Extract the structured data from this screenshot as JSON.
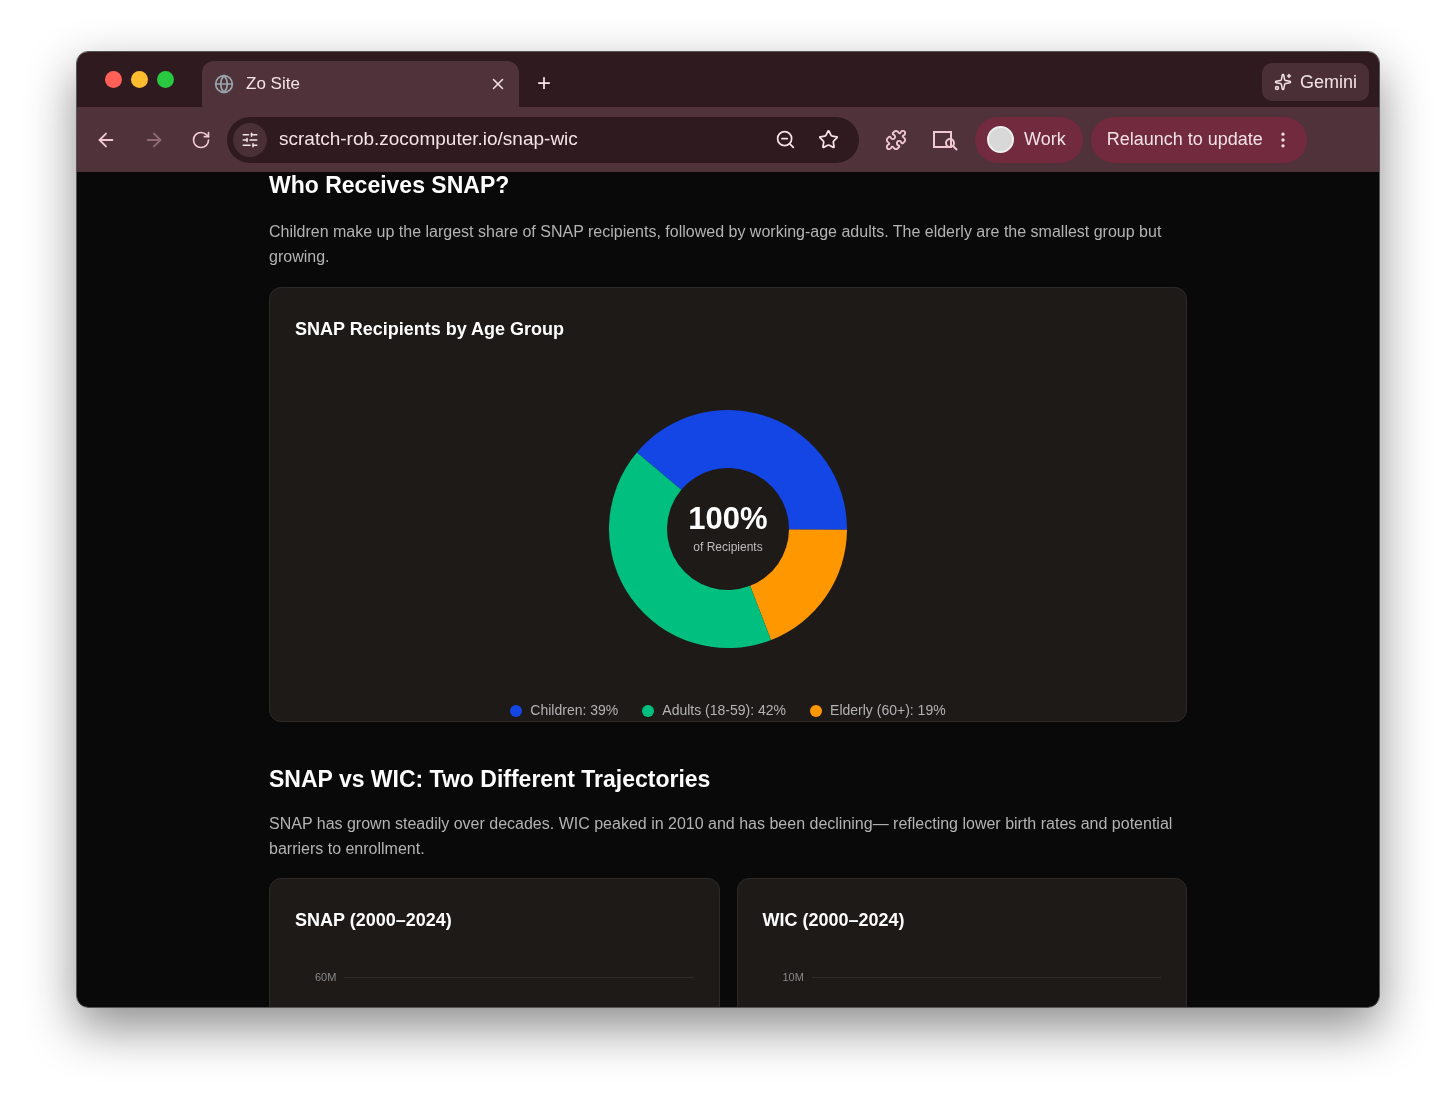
{
  "browser": {
    "tab": {
      "title": "Zo Site",
      "selected": true
    },
    "new_tab": "+",
    "gemini": "Gemini",
    "url": "scratch-rob.zocomputer.io/snap-wic",
    "profile": "Work",
    "relaunch": "Relaunch to update"
  },
  "sections": [
    {
      "heading": "Who Receives SNAP?",
      "text": "Children make up the largest share of SNAP recipients, followed by working-age adults. The elderly are the smallest group but growing.",
      "cards": [
        {
          "title": "SNAP Recipients by Age Group",
          "center_value": "100%",
          "center_label": "of Recipients",
          "legend": [
            ": 39%",
            ": 42%",
            ": 19%"
          ],
          "chart_data": {
            "type": "donut",
            "categories": [
              "Children",
              "Adults (18-59)",
              "Elderly (60+)"
            ],
            "values": [
              39,
              42,
              19
            ],
            "colors": [
              "#1446e6",
              "#00bf7f",
              "#ff9800"
            ]
          }
        }
      ]
    },
    {
      "heading": "SNAP vs WIC: Two Different Trajectories",
      "text": "SNAP has grown steadily over decades. WIC peaked in 2010 and has been declining— reflecting lower birth rates and potential barriers to enrollment.",
      "cards": [
        {
          "title": "SNAP (2000–2024)",
          "top_tick": "60M"
        },
        {
          "title": "WIC (2000–2024)",
          "top_tick": "10M"
        }
      ]
    }
  ]
}
